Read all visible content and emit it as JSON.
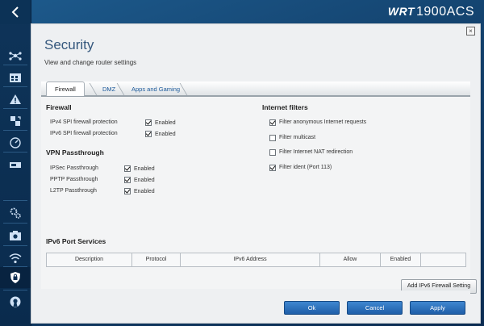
{
  "header": {
    "brand_prefix": "WRT",
    "brand_model": "1900ACS"
  },
  "page": {
    "title": "Security",
    "subtitle": "View and change router settings",
    "close_symbol": "×"
  },
  "tabs": [
    {
      "label": "Firewall",
      "active": true
    },
    {
      "label": "DMZ",
      "active": false
    },
    {
      "label": "Apps and Gaming",
      "active": false
    }
  ],
  "firewall": {
    "heading": "Firewall",
    "rows": [
      {
        "label": "IPv4 SPI firewall protection",
        "checked": true,
        "text": "Enabled"
      },
      {
        "label": "IPv6 SPI firewall protection",
        "checked": true,
        "text": "Enabled"
      }
    ]
  },
  "vpn": {
    "heading": "VPN Passthrough",
    "rows": [
      {
        "label": "IPSec Passthrough",
        "checked": true,
        "text": "Enabled"
      },
      {
        "label": "PPTP Passthrough",
        "checked": true,
        "text": "Enabled"
      },
      {
        "label": "L2TP Passthrough",
        "checked": true,
        "text": "Enabled"
      }
    ]
  },
  "internet_filters": {
    "heading": "Internet filters",
    "items": [
      {
        "label": "Filter anonymous Internet requests",
        "checked": true
      },
      {
        "label": "Filter multicast",
        "checked": false
      },
      {
        "label": "Filter Internet NAT redirection",
        "checked": false
      },
      {
        "label": "Filter ident (Port 113)",
        "checked": true
      }
    ]
  },
  "ipv6": {
    "heading": "IPv6 Port Services",
    "columns": [
      "Description",
      "Protocol",
      "IPv6 Address",
      "Allow",
      "Enabled",
      ""
    ],
    "add_button": "Add IPv6 Firewall Setting"
  },
  "footer": {
    "ok": "Ok",
    "cancel": "Cancel",
    "apply": "Apply"
  },
  "sidebar": {
    "icons": [
      "network-map-icon",
      "calendar-icon",
      "warning-icon",
      "media-prioritization-icon",
      "speed-test-icon",
      "storage-icon",
      "settings-gears-icon",
      "camera-icon",
      "wifi-icon",
      "security-shield-icon",
      "openvpn-icon"
    ]
  },
  "colors": {
    "accent": "#33567c",
    "button_blue": "#1f5ea8",
    "rail": "#0e3459"
  }
}
